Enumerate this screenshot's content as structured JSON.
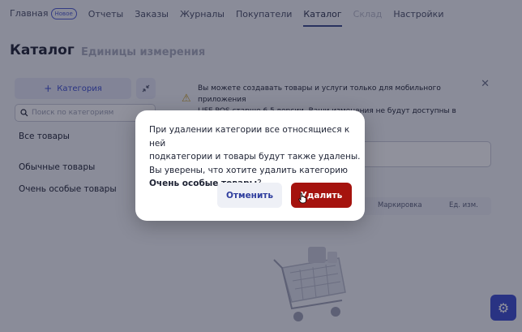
{
  "nav": {
    "items": [
      {
        "label": "Главная",
        "badge": "Новое",
        "state": "normal"
      },
      {
        "label": "Отчеты",
        "state": "normal"
      },
      {
        "label": "Заказы",
        "state": "normal"
      },
      {
        "label": "Журналы",
        "state": "normal"
      },
      {
        "label": "Покупатели",
        "state": "normal"
      },
      {
        "label": "Каталог",
        "state": "active"
      },
      {
        "label": "Склад",
        "state": "disabled"
      },
      {
        "label": "Настройки",
        "state": "normal"
      }
    ]
  },
  "page": {
    "title": "Каталог",
    "secondary_tab": "Единицы измерения"
  },
  "left_panel": {
    "add_category_label": "Категория",
    "add_category_icon": "plus-icon",
    "collapse_icon": "collapse-arrows-icon",
    "search_placeholder": "Поиск по категориям",
    "categories": [
      "Все товары",
      "Обычные товары",
      "Очень особые товары"
    ]
  },
  "notice": {
    "line1": "Вы можете создавать товары и услуги только для мобильного приложения",
    "line2": "LIFE POS старше 6.5 версии. Ваши изменения не будут доступны в старом",
    "icon": "warning-icon"
  },
  "table": {
    "headers": [
      "Маркировка",
      "Ед. изм."
    ]
  },
  "dialog": {
    "line1": "При удалении категории все относящиеся к ней",
    "line2": "подкатегории и товары будут также удалены.",
    "line3": "Вы уверены, что хотите удалить категорию",
    "category_name": "Очень особые товары",
    "question_mark": "?",
    "cancel_label": "Отменить",
    "delete_label": "Удалить"
  },
  "colors": {
    "accent": "#3b4ccf",
    "danger": "#a5130e",
    "overlay": "#161a30"
  }
}
